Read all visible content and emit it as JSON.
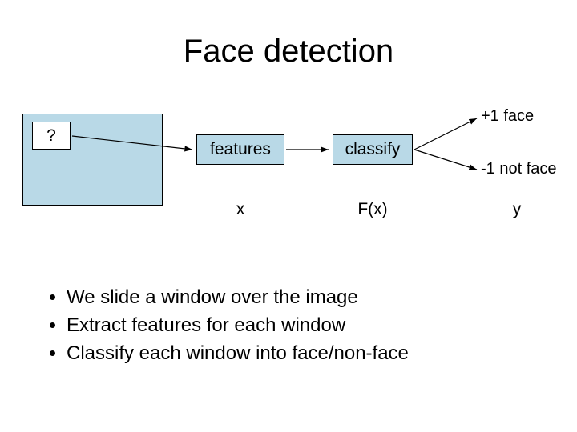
{
  "title": "Face detection",
  "window_marker": "?",
  "stages": {
    "features": "features",
    "classify": "classify"
  },
  "outputs": {
    "positive": "+1 face",
    "negative": "-1 not face"
  },
  "row_labels": {
    "x": "x",
    "fx": "F(x)",
    "y": "y"
  },
  "bullets": [
    "We slide a window over the image",
    "Extract features for each window",
    "Classify each window into face/non-face"
  ]
}
